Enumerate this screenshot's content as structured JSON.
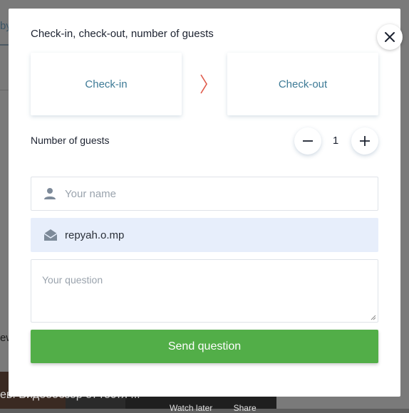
{
  "background": {
    "fragment_top": "by",
    "fragment_mid": "ew",
    "video_title": "ев. Видеообзор от гостя ...",
    "video_actions": [
      "Watch later",
      "Share"
    ]
  },
  "modal": {
    "title": "Check-in, check-out, number of guests",
    "close_icon": "close-icon"
  },
  "dates": {
    "checkin_label": "Check-in",
    "checkout_label": "Check-out",
    "arrow_icon": "chevron-right-icon",
    "arrow_color": "#e05a4a"
  },
  "guests": {
    "label": "Number of guests",
    "value": "1",
    "minus_icon": "minus-icon",
    "plus_icon": "plus-icon"
  },
  "form": {
    "name_placeholder": "Your name",
    "name_value": "",
    "email_value": "repyah.o.mp",
    "question_placeholder": "Your question",
    "question_value": "",
    "person_icon": "person-icon",
    "mail_icon": "mail-open-icon",
    "send_label": "Send question"
  },
  "colors": {
    "accent_text": "#3d7a96",
    "send_button": "#52ae48",
    "email_field_bg": "#e7eefb"
  }
}
